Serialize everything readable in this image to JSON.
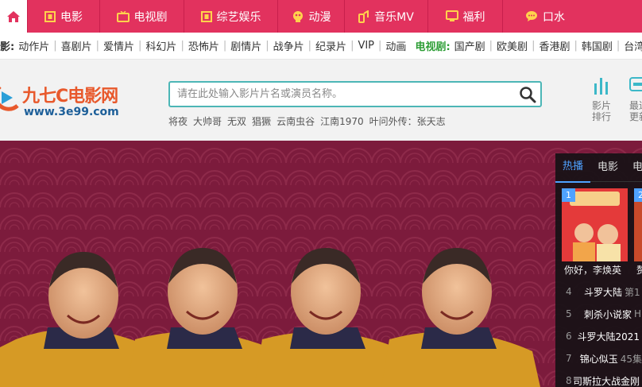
{
  "nav": {
    "items": [
      {
        "label": "电影",
        "icon": "film-icon"
      },
      {
        "label": "电视剧",
        "icon": "tv-icon"
      },
      {
        "label": "综艺娱乐",
        "icon": "film-icon"
      },
      {
        "label": "动漫",
        "icon": "anime-icon"
      },
      {
        "label": "音乐MV",
        "icon": "music-icon"
      },
      {
        "label": "福利",
        "icon": "monitor-icon"
      },
      {
        "label": "口水",
        "icon": "chat-icon"
      }
    ],
    "accent": "#e2325e"
  },
  "categories": {
    "movie_label": "影:",
    "movie_links": [
      "动作片",
      "喜剧片",
      "爱情片",
      "科幻片",
      "恐怖片",
      "剧情片",
      "战争片",
      "纪录片",
      "VIP",
      "动画"
    ],
    "tv_label": "电视剧:",
    "tv_links": [
      "国产剧",
      "欧美剧",
      "香港剧",
      "韩国剧",
      "台湾剧"
    ]
  },
  "header": {
    "logo_text": "九七C电影网",
    "logo_url": "www.3e99.com",
    "search_placeholder": "请在此处输入影片片名或演员名称。",
    "hot_words": [
      "将夜",
      "大帅哥",
      "无双",
      "猖獗",
      "云南虫谷",
      "江南1970",
      "叶问外传：张天志"
    ],
    "rank_label_1": "影片",
    "rank_label_2": "排行",
    "newest_label_1": "最近",
    "newest_label_2": "更新"
  },
  "hot_panel": {
    "tabs": [
      "热播",
      "电影",
      "电"
    ],
    "featured": [
      {
        "rank": "1",
        "caption": "你好，李焕英"
      },
      {
        "rank": "2",
        "caption": "赘婿"
      }
    ],
    "list": [
      {
        "rank": "4",
        "title": "斗罗大陆",
        "extra": "第1"
      },
      {
        "rank": "5",
        "title": "刺杀小说家",
        "extra": "H"
      },
      {
        "rank": "6",
        "title": "斗罗大陆2021",
        "extra": ""
      },
      {
        "rank": "7",
        "title": "锦心似玉",
        "extra": "45集"
      },
      {
        "rank": "8",
        "title": "司斯拉大战金刚",
        "extra": ""
      }
    ]
  }
}
